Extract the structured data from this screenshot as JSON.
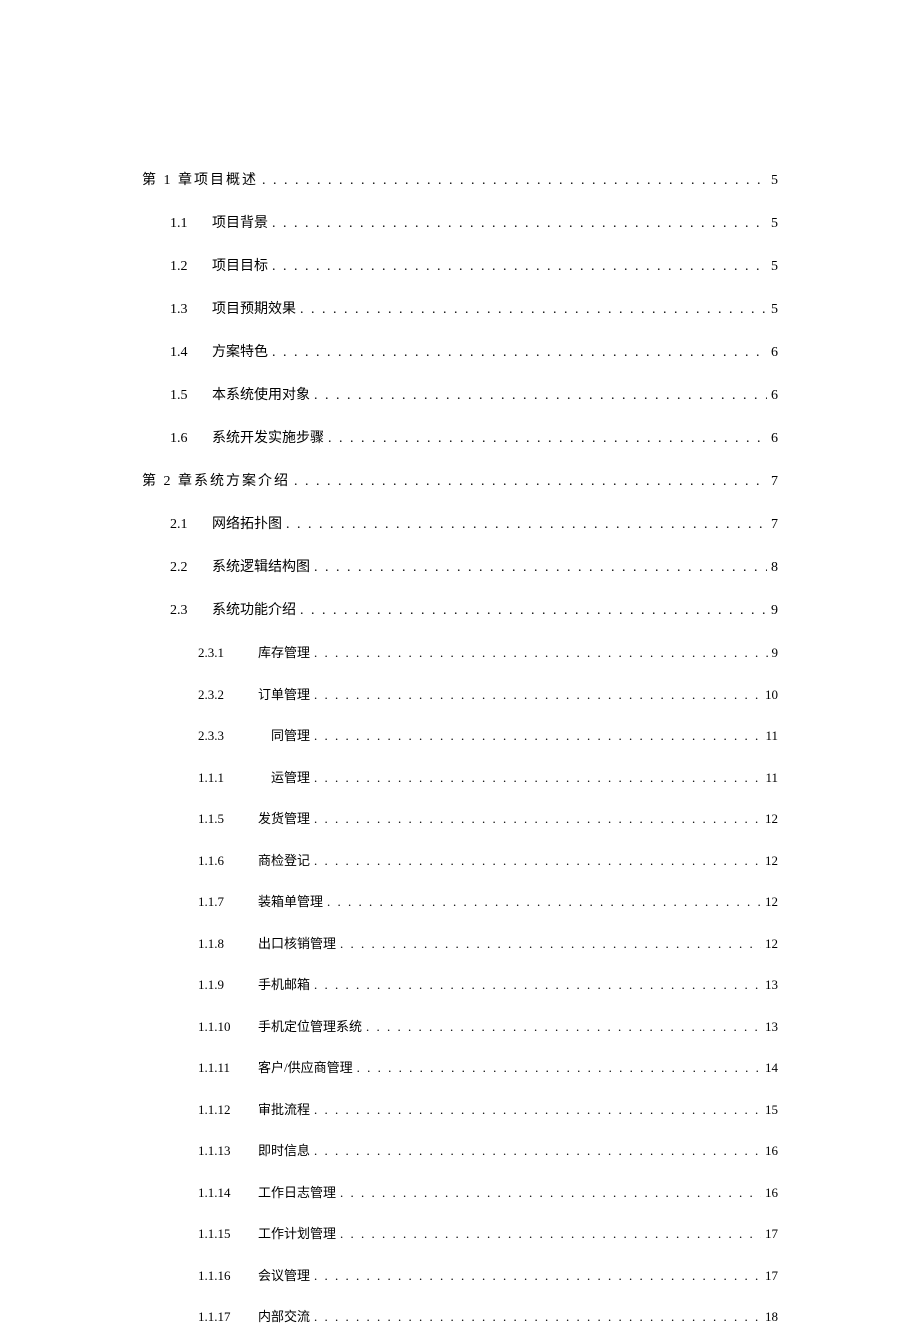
{
  "toc": [
    {
      "level": 0,
      "num": "",
      "title": "第 1 章项目概述",
      "page": "5"
    },
    {
      "level": 1,
      "num": "1.1",
      "title": "项目背景",
      "page": "5"
    },
    {
      "level": 1,
      "num": "1.2",
      "title": "项目目标",
      "page": "5"
    },
    {
      "level": 1,
      "num": "1.3",
      "title": "项目预期效果",
      "page": "5"
    },
    {
      "level": 1,
      "num": "1.4",
      "title": "方案特色",
      "page": "6"
    },
    {
      "level": 1,
      "num": "1.5",
      "title": "本系统使用对象",
      "page": "6"
    },
    {
      "level": 1,
      "num": "1.6",
      "title": "系统开发实施步骤",
      "page": "6"
    },
    {
      "level": 0,
      "num": "",
      "title": "第 2 章系统方案介绍",
      "page": "7"
    },
    {
      "level": 1,
      "num": "2.1",
      "title": "网络拓扑图",
      "page": "7"
    },
    {
      "level": 1,
      "num": "2.2",
      "title": "系统逻辑结构图",
      "page": "8"
    },
    {
      "level": 1,
      "num": "2.3",
      "title": "系统功能介绍",
      "page": "9"
    },
    {
      "level": 2,
      "num": "2.3.1",
      "title": "库存管理",
      "page": "9"
    },
    {
      "level": 2,
      "num": "2.3.2",
      "title": "订单管理",
      "page": "10"
    },
    {
      "level": 2,
      "num": "2.3.3",
      "title": "　同管理",
      "page": "11"
    },
    {
      "level": 2,
      "num": "1.1.1",
      "title": "　运管理",
      "page": "11"
    },
    {
      "level": 2,
      "num": "1.1.5",
      "title": "发货管理",
      "page": "12"
    },
    {
      "level": 2,
      "num": "1.1.6",
      "title": "商检登记",
      "page": "12"
    },
    {
      "level": 2,
      "num": "1.1.7",
      "title": "装箱单管理",
      "page": "12"
    },
    {
      "level": 2,
      "num": "1.1.8",
      "title": "出口核销管理",
      "page": "12"
    },
    {
      "level": 2,
      "num": "1.1.9",
      "title": "手机邮箱",
      "page": "13"
    },
    {
      "level": 2,
      "num": "1.1.10",
      "title": "手机定位管理系统",
      "page": "13"
    },
    {
      "level": 2,
      "num": "1.1.11",
      "title": "客户/供应商管理",
      "page": "14"
    },
    {
      "level": 2,
      "num": "1.1.12",
      "title": "审批流程",
      "page": "15"
    },
    {
      "level": 2,
      "num": "1.1.13",
      "title": "即时信息",
      "page": "16"
    },
    {
      "level": 2,
      "num": "1.1.14",
      "title": "工作日志管理",
      "page": "16"
    },
    {
      "level": 2,
      "num": "1.1.15",
      "title": "工作计划管理",
      "page": "17"
    },
    {
      "level": 2,
      "num": "1.1.16",
      "title": "会议管理",
      "page": "17"
    },
    {
      "level": 2,
      "num": "1.1.17",
      "title": "内部交流",
      "page": "18"
    }
  ]
}
